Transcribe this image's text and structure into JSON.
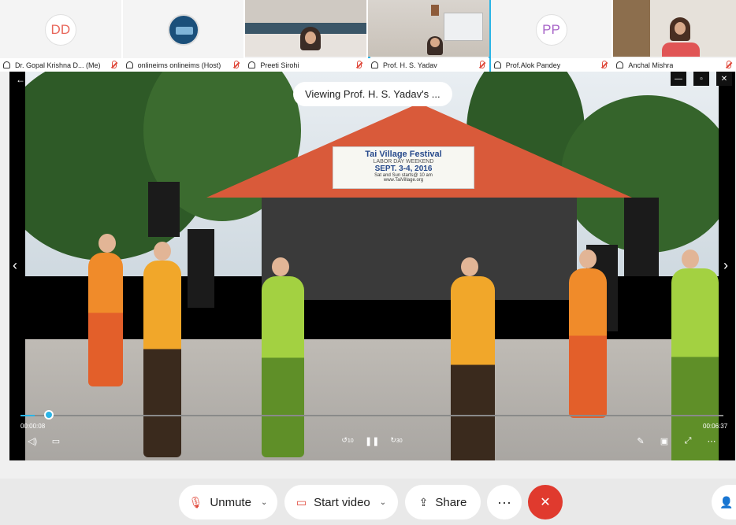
{
  "participants": [
    {
      "name": "Dr. Gopal Krishna D... (Me)",
      "initials": "DD",
      "muted": true,
      "active": false
    },
    {
      "name": "onlineims onlineims (Host)",
      "initials": "",
      "muted": true,
      "active": false
    },
    {
      "name": "Preeti Sirohi",
      "initials": "",
      "muted": true,
      "active": false
    },
    {
      "name": "Prof. H. S. Yadav",
      "initials": "",
      "muted": true,
      "active": true
    },
    {
      "name": "Prof.Alok Pandey",
      "initials": "PP",
      "muted": true,
      "active": false
    },
    {
      "name": "Anchal Mishra",
      "initials": "",
      "muted": true,
      "active": false
    }
  ],
  "viewer": {
    "viewing_label": "Viewing Prof. H. S. Yadav's ...",
    "banner_title": "Tai Village Festival",
    "banner_sub": "LABOR DAY WEEKEND",
    "banner_date": "SEPT. 3-4, 2016",
    "banner_time": "Sat and Sun starts@ 10 am",
    "banner_url": "www.TaiVillage.org",
    "time_current": "00:00:08",
    "time_total": "00:06:37",
    "progress": 0.02,
    "skip_back": "10",
    "skip_forward": "30"
  },
  "toolbar": {
    "unmute_label": "Unmute",
    "start_video_label": "Start video",
    "share_label": "Share",
    "more_label": "···",
    "end_label": "✕"
  },
  "icons": {
    "mic_muted_color": "#e04a3c",
    "accent": "#2ab4e6",
    "end_color": "#e03a2e"
  }
}
